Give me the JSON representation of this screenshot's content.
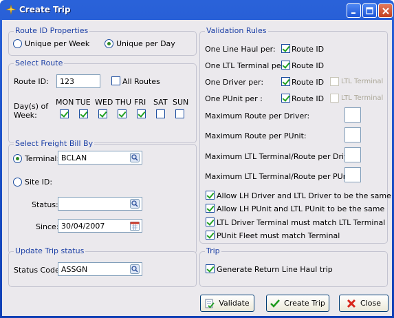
{
  "window": {
    "title": "Create Trip"
  },
  "route_id_properties": {
    "title": "Route ID Properties",
    "unique_per_week": "Unique per Week",
    "unique_per_day": "Unique per Day"
  },
  "select_route": {
    "title": "Select Route",
    "route_id_label": "Route ID:",
    "route_id_value": "123",
    "all_routes_label": "All Routes",
    "days_label_1": "Day(s) of",
    "days_label_2": "Week:",
    "days": [
      "MON",
      "TUE",
      "WED",
      "THU",
      "FRI",
      "SAT",
      "SUN"
    ]
  },
  "freight_bill": {
    "title": "Select Freight Bill By",
    "terminal_label": "Terminal:",
    "terminal_value": "BCLAN",
    "site_id_label": "Site ID:",
    "status_label": "Status:",
    "status_value": "",
    "since_label": "Since:",
    "since_value": "30/04/2007"
  },
  "update_status": {
    "title": "Update Trip status",
    "status_code_label": "Status Code:",
    "status_code_value": "ASSGN"
  },
  "validation": {
    "title": "Validation Rules",
    "line_haul_label": "One Line Haul per:",
    "ltl_terminal_label": "One LTL Terminal per:",
    "driver_label": "One Driver per:",
    "punit_label": "One PUnit per :",
    "route_id_option": "Route ID",
    "ltl_terminal_option": "LTL Terminal",
    "max_route_driver": "Maximum Route per Driver:",
    "max_route_punit": "Maximum Route per PUnit:",
    "max_ltl_driver": "Maximum LTL Terminal/Route per Driver:",
    "max_ltl_punit": "Maximum LTL Terminal/Route per PUnit:",
    "allow_lh_driver": "Allow LH Driver and LTL Driver to be the same",
    "allow_lh_punit": "Allow LH PUnit and LTL PUnit to be the same",
    "ltl_driver_terminal": "LTL Driver Terminal must match LTL Terminal",
    "punit_fleet": "PUnit Fleet must match Terminal"
  },
  "trip": {
    "title": "Trip",
    "generate_return": "Generate Return Line Haul trip"
  },
  "buttons": {
    "validate": "Validate",
    "create_trip": "Create Trip",
    "close": "Close"
  }
}
